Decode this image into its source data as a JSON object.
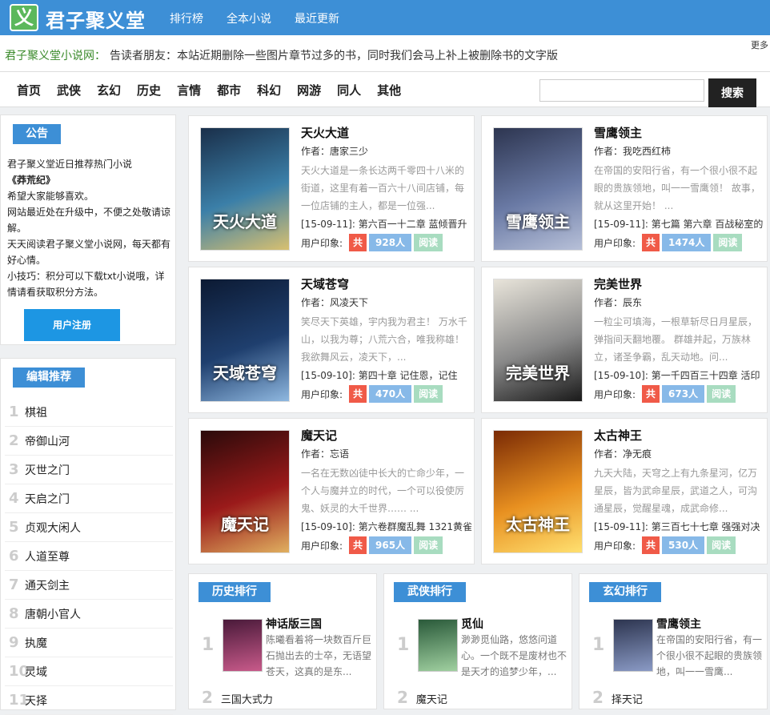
{
  "header": {
    "logo_char": "义",
    "site_title": "君子聚义堂",
    "nav": [
      "排行榜",
      "全本小说",
      "最近更新"
    ]
  },
  "notice": {
    "label": "君子聚义堂小说网：",
    "text": "告读者朋友：本站近期删除一些图片章节过多的书，同时我们会马上补上被删除书的文字版",
    "more": "更多"
  },
  "categories": [
    "首页",
    "武侠",
    "玄幻",
    "历史",
    "言情",
    "都市",
    "科幻",
    "网游",
    "同人",
    "其他"
  ],
  "search": {
    "button": "搜索",
    "value": ""
  },
  "announcement": {
    "tag": "公告",
    "lines": [
      "君子聚义堂近日推荐热门小说",
      "《莽荒纪》",
      "希望大家能够喜欢。",
      "网站最近处在升级中，不便之处敬请谅解。",
      "天天阅读君子聚义堂小说网，每天都有好心情。",
      "小技巧：积分可以下载txt小说哦，详情请看获取积分方法。"
    ],
    "register_button": "用户注册"
  },
  "editor_pick": {
    "tag": "编辑推荐",
    "items": [
      {
        "num": "1",
        "title": "棋祖"
      },
      {
        "num": "2",
        "title": "帝御山河"
      },
      {
        "num": "3",
        "title": "灭世之门"
      },
      {
        "num": "4",
        "title": "天启之门"
      },
      {
        "num": "5",
        "title": "贞观大闲人"
      },
      {
        "num": "6",
        "title": "人道至尊"
      },
      {
        "num": "7",
        "title": "通天剑主"
      },
      {
        "num": "8",
        "title": "唐朝小官人"
      },
      {
        "num": "9",
        "title": "执魔"
      },
      {
        "num": "10",
        "title": "灵域"
      },
      {
        "num": "11",
        "title": "天择"
      }
    ]
  },
  "books": [
    {
      "title": "天火大道",
      "author": "作者：唐家三少",
      "desc": "天火大道是一条长达两千零四十八米的街道，这里有着一百六十八间店铺，每一位店铺的主人，都是一位强...",
      "chapter": "[15-09-11]: 第六百一十二章 蓝倾晋升",
      "impression": "用户印象:",
      "gong": "共",
      "count": "928人",
      "read": "阅读",
      "cover_colors": [
        "#1a2f4a",
        "#3b7fa8",
        "#d8c070"
      ],
      "cover_text": "天火大道"
    },
    {
      "title": "雪鹰领主",
      "author": "作者：我吃西红柿",
      "desc": "在帝国的安阳行省，有一个很小很不起眼的贵族领地，叫一一雪鹰领！ 故事，就从这里开始！ ...",
      "chapter": "[15-09-11]: 第七篇 第六章 百战秘室的",
      "impression": "用户印象:",
      "gong": "共",
      "count": "1474人",
      "read": "阅读",
      "cover_colors": [
        "#2d3550",
        "#6a7aa5",
        "#b7c0d8"
      ],
      "cover_text": "雪鹰领主"
    },
    {
      "title": "天域苍穹",
      "author": "作者：风凌天下",
      "desc": "笑尽天下英雄，宇内我为君主！ 万水千山，以我为尊；八荒六合，唯我称雄！ 我欲舞风云，凌天下，...",
      "chapter": "[15-09-10]: 第四十章 记住恩，记住",
      "impression": "用户印象:",
      "gong": "共",
      "count": "470人",
      "read": "阅读",
      "cover_colors": [
        "#0c1a33",
        "#1f3f6e",
        "#8fb8e0"
      ],
      "cover_text": "天域苍穹"
    },
    {
      "title": "完美世界",
      "author": "作者：辰东",
      "desc": "一粒尘可填海，一根草斩尽日月星辰，弹指间天翻地覆。 群雄并起，万族林立，诸圣争霸，乱天动地。问...",
      "chapter": "[15-09-10]: 第一千四百三十四章 活印",
      "impression": "用户印象:",
      "gong": "共",
      "count": "673人",
      "read": "阅读",
      "cover_colors": [
        "#e8e4da",
        "#8a8a8a",
        "#1a1a1a"
      ],
      "cover_text": "完美世界"
    },
    {
      "title": "魔天记",
      "author": "作者：忘语",
      "desc": "一名在无数凶徒中长大的亡命少年，一个人与魔并立的时代，一个可以役使厉鬼、妖灵的大千世界…… ...",
      "chapter": "[15-09-10]: 第六卷群魔乱舞 1321黄雀",
      "impression": "用户印象:",
      "gong": "共",
      "count": "965人",
      "read": "阅读",
      "cover_colors": [
        "#2a0a0a",
        "#9a1a1a",
        "#e0b060"
      ],
      "cover_text": "魔天记"
    },
    {
      "title": "太古神王",
      "author": "作者：净无痕",
      "desc": "九天大陆，天穹之上有九条星河，亿万星辰，皆为武命星辰，武道之人，可沟通星辰，觉醒星魂，成武命修...",
      "chapter": "[15-09-11]: 第三百七十七章 强强对决",
      "impression": "用户印象:",
      "gong": "共",
      "count": "530人",
      "read": "阅读",
      "cover_colors": [
        "#7a2a05",
        "#e89020",
        "#ffe070"
      ],
      "cover_text": "太古神王"
    }
  ],
  "rankings": [
    {
      "tag": "历史排行",
      "top": {
        "num": "1",
        "title": "神话版三国",
        "desc": "陈曦看着将一块数百斤巨石抛出去的士卒，无语望苍天，这真的是东...",
        "cover_colors": [
          "#4a1a3a",
          "#c85a8a"
        ]
      },
      "second": {
        "num": "2",
        "title": "三国大式力"
      }
    },
    {
      "tag": "武侠排行",
      "top": {
        "num": "1",
        "title": "觅仙",
        "desc": "渺渺觅仙路，悠悠问道心。一个既不是废材也不是天才的追梦少年，...",
        "cover_colors": [
          "#2a5a3a",
          "#a0d0a0"
        ]
      },
      "second": {
        "num": "2",
        "title": "魔天记"
      }
    },
    {
      "tag": "玄幻排行",
      "top": {
        "num": "1",
        "title": "雪鹰领主",
        "desc": "在帝国的安阳行省，有一个很小很不起眼的贵族领地，叫一一雪鹰...",
        "cover_colors": [
          "#2d3550",
          "#8a9ac5"
        ]
      },
      "second": {
        "num": "2",
        "title": "择天记"
      }
    }
  ]
}
